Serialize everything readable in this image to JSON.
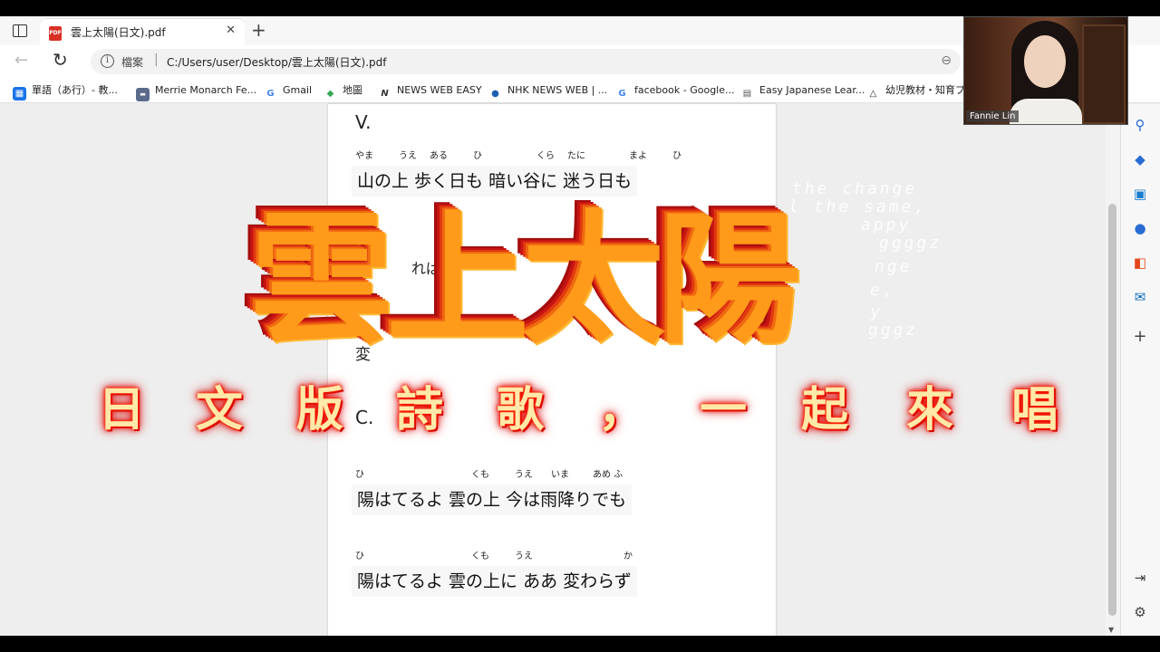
{
  "browser": {
    "tab_title": "雲上太陽(日文).pdf",
    "tab_icon_text": "PDF",
    "close": "✕",
    "new_tab": "+",
    "url_label": "檔案",
    "url_sep": "|",
    "url": "C:/Users/user/Desktop/雲上太陽(日文).pdf",
    "back": "←",
    "reload": "↻",
    "info": "i",
    "zoom": "⊖"
  },
  "bookmarks": [
    {
      "label": "單語（あ行）- 教...",
      "icon": "grid-icon",
      "color": "#1a73e8",
      "glyph": "▦"
    },
    {
      "label": "Merrie Monarch Fe...",
      "icon": "news-icon",
      "color": "#5a6a8a",
      "glyph": "▬"
    },
    {
      "label": "Gmail",
      "icon": "google-icon",
      "color": "#ffffff",
      "glyph": "G"
    },
    {
      "label": "地圖",
      "icon": "maps-icon",
      "color": "#34a853",
      "glyph": "◆"
    },
    {
      "label": "NEWS WEB EASY",
      "icon": "nhk-n-icon",
      "color": "#ffffff",
      "glyph": "N"
    },
    {
      "label": "NHK NEWS WEB | ...",
      "icon": "nhk-icon",
      "color": "#1a5fb4",
      "glyph": "●"
    },
    {
      "label": "facebook - Google...",
      "icon": "google-icon",
      "color": "#ffffff",
      "glyph": "G"
    },
    {
      "label": "Easy Japanese Lear...",
      "icon": "nhk-world-icon",
      "color": "#555555",
      "glyph": "▤"
    },
    {
      "label": "幼児教材・知育プ...",
      "icon": "warning-icon",
      "color": "#ffffff",
      "glyph": "△"
    }
  ],
  "pdf": {
    "section_v": "V.",
    "section_c": "C.",
    "ruby1": [
      "やま",
      "うえ",
      "ある",
      "ひ",
      "くら",
      "たに",
      "まよ",
      "ひ"
    ],
    "line1": "山の上  歩く日も     暗い谷に    迷う日も",
    "frag1": "れば",
    "frag2": "変",
    "ruby2": [
      "ひ",
      "くも",
      "うえ",
      "いま",
      "あめ ふ"
    ],
    "line2": "陽はてるよ   雲の上   今は雨降りでも",
    "ruby3": [
      "ひ",
      "くも",
      "うえ",
      "か"
    ],
    "line3": "陽はてるよ   雲の上に  ああ   変わらず"
  },
  "webcam": {
    "name": "Fannie Lin"
  },
  "overlay": {
    "title": "雲上太陽",
    "subtitle_chars": [
      "日",
      "文",
      "版",
      "詩",
      "歌",
      "，",
      "一",
      "起",
      "來",
      "唱"
    ],
    "ghost_lines": [
      "the change",
      "l the same,",
      "appy",
      "ggggz",
      "nge",
      "e,",
      "y",
      "gggz"
    ]
  },
  "sidebar_icons": [
    "search-icon",
    "tag-icon",
    "toolbox-icon",
    "people-icon",
    "office-icon",
    "outlook-icon",
    "plus-icon",
    "exit-icon",
    "gear-icon"
  ]
}
